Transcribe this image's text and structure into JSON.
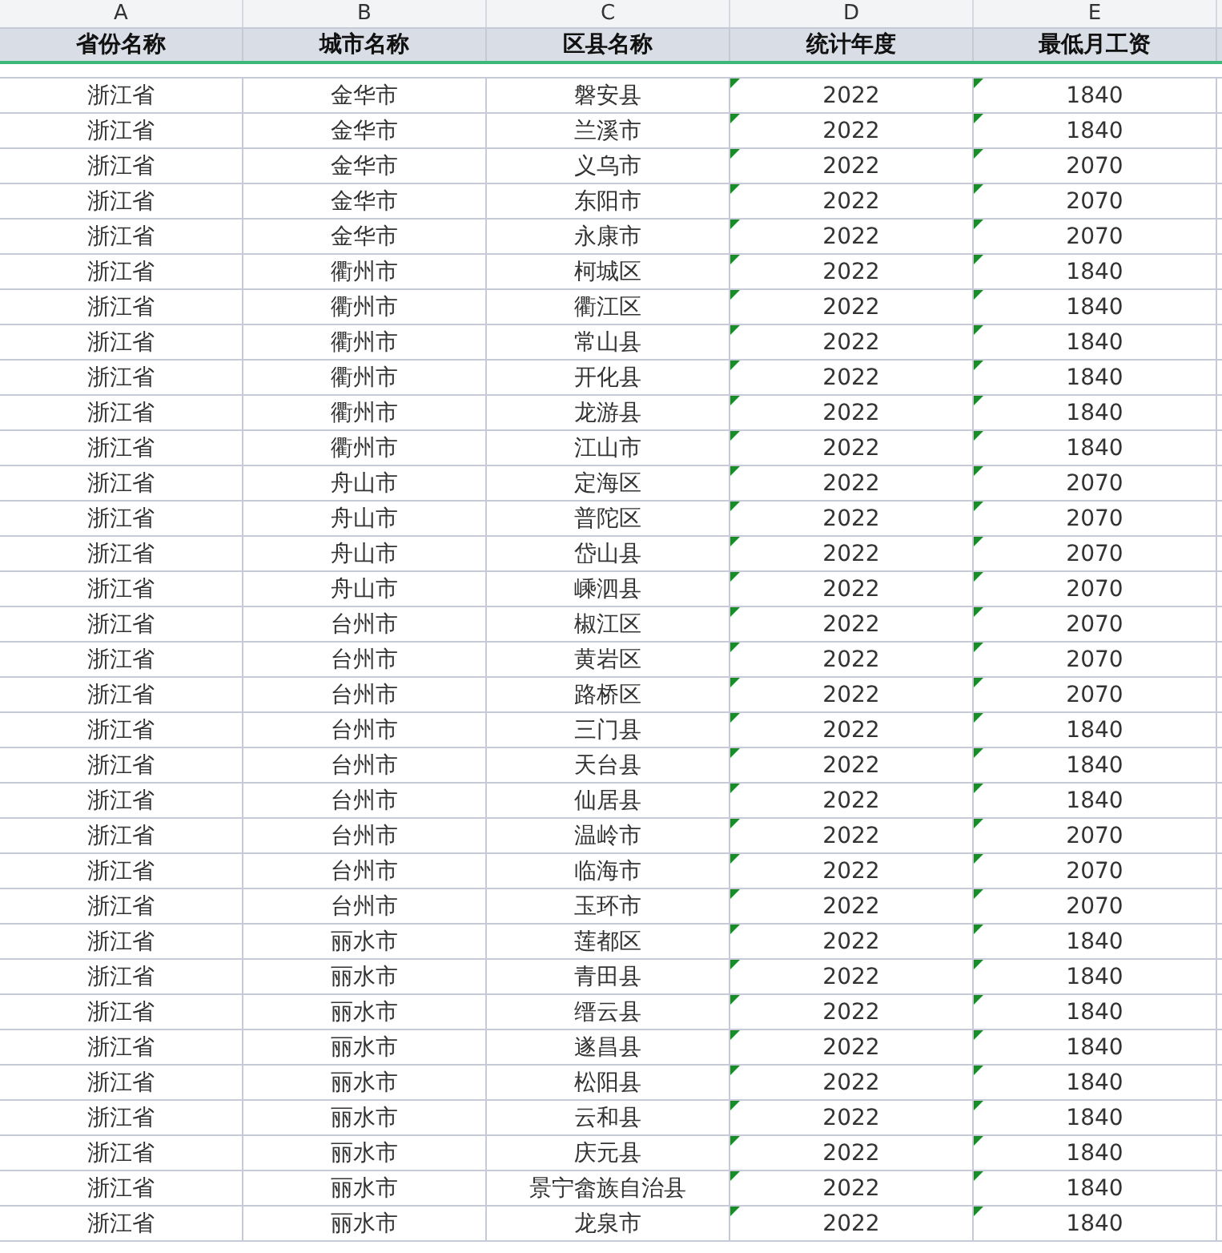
{
  "column_letters": [
    "A",
    "B",
    "C",
    "D",
    "E"
  ],
  "headers": [
    "省份名称",
    "城市名称",
    "区县名称",
    "统计年度",
    "最低月工资"
  ],
  "rows": [
    {
      "cells": [
        "浙江省",
        "金华市",
        "磐安县",
        "2022",
        "1840"
      ],
      "flagged": true
    },
    {
      "cells": [
        "浙江省",
        "金华市",
        "兰溪市",
        "2022",
        "1840"
      ],
      "flagged": true
    },
    {
      "cells": [
        "浙江省",
        "金华市",
        "义乌市",
        "2022",
        "2070"
      ],
      "flagged": true
    },
    {
      "cells": [
        "浙江省",
        "金华市",
        "东阳市",
        "2022",
        "2070"
      ],
      "flagged": true
    },
    {
      "cells": [
        "浙江省",
        "金华市",
        "永康市",
        "2022",
        "2070"
      ],
      "flagged": true
    },
    {
      "cells": [
        "浙江省",
        "衢州市",
        "柯城区",
        "2022",
        "1840"
      ],
      "flagged": true
    },
    {
      "cells": [
        "浙江省",
        "衢州市",
        "衢江区",
        "2022",
        "1840"
      ],
      "flagged": true
    },
    {
      "cells": [
        "浙江省",
        "衢州市",
        "常山县",
        "2022",
        "1840"
      ],
      "flagged": true
    },
    {
      "cells": [
        "浙江省",
        "衢州市",
        "开化县",
        "2022",
        "1840"
      ],
      "flagged": true
    },
    {
      "cells": [
        "浙江省",
        "衢州市",
        "龙游县",
        "2022",
        "1840"
      ],
      "flagged": true
    },
    {
      "cells": [
        "浙江省",
        "衢州市",
        "江山市",
        "2022",
        "1840"
      ],
      "flagged": true
    },
    {
      "cells": [
        "浙江省",
        "舟山市",
        "定海区",
        "2022",
        "2070"
      ],
      "flagged": true
    },
    {
      "cells": [
        "浙江省",
        "舟山市",
        "普陀区",
        "2022",
        "2070"
      ],
      "flagged": true
    },
    {
      "cells": [
        "浙江省",
        "舟山市",
        "岱山县",
        "2022",
        "2070"
      ],
      "flagged": true
    },
    {
      "cells": [
        "浙江省",
        "舟山市",
        "嵊泗县",
        "2022",
        "2070"
      ],
      "flagged": true
    },
    {
      "cells": [
        "浙江省",
        "台州市",
        "椒江区",
        "2022",
        "2070"
      ],
      "flagged": true
    },
    {
      "cells": [
        "浙江省",
        "台州市",
        "黄岩区",
        "2022",
        "2070"
      ],
      "flagged": true
    },
    {
      "cells": [
        "浙江省",
        "台州市",
        "路桥区",
        "2022",
        "2070"
      ],
      "flagged": true
    },
    {
      "cells": [
        "浙江省",
        "台州市",
        "三门县",
        "2022",
        "1840"
      ],
      "flagged": true
    },
    {
      "cells": [
        "浙江省",
        "台州市",
        "天台县",
        "2022",
        "1840"
      ],
      "flagged": true
    },
    {
      "cells": [
        "浙江省",
        "台州市",
        "仙居县",
        "2022",
        "1840"
      ],
      "flagged": true
    },
    {
      "cells": [
        "浙江省",
        "台州市",
        "温岭市",
        "2022",
        "2070"
      ],
      "flagged": true
    },
    {
      "cells": [
        "浙江省",
        "台州市",
        "临海市",
        "2022",
        "2070"
      ],
      "flagged": true
    },
    {
      "cells": [
        "浙江省",
        "台州市",
        "玉环市",
        "2022",
        "2070"
      ],
      "flagged": true
    },
    {
      "cells": [
        "浙江省",
        "丽水市",
        "莲都区",
        "2022",
        "1840"
      ],
      "flagged": true
    },
    {
      "cells": [
        "浙江省",
        "丽水市",
        "青田县",
        "2022",
        "1840"
      ],
      "flagged": true
    },
    {
      "cells": [
        "浙江省",
        "丽水市",
        "缙云县",
        "2022",
        "1840"
      ],
      "flagged": true
    },
    {
      "cells": [
        "浙江省",
        "丽水市",
        "遂昌县",
        "2022",
        "1840"
      ],
      "flagged": true
    },
    {
      "cells": [
        "浙江省",
        "丽水市",
        "松阳县",
        "2022",
        "1840"
      ],
      "flagged": true
    },
    {
      "cells": [
        "浙江省",
        "丽水市",
        "云和县",
        "2022",
        "1840"
      ],
      "flagged": true
    },
    {
      "cells": [
        "浙江省",
        "丽水市",
        "庆元县",
        "2022",
        "1840"
      ],
      "flagged": true
    },
    {
      "cells": [
        "浙江省",
        "丽水市",
        "景宁畲族自治县",
        "2022",
        "1840"
      ],
      "flagged": true
    },
    {
      "cells": [
        "浙江省",
        "丽水市",
        "龙泉市",
        "2022",
        "1840"
      ],
      "flagged": true
    }
  ]
}
